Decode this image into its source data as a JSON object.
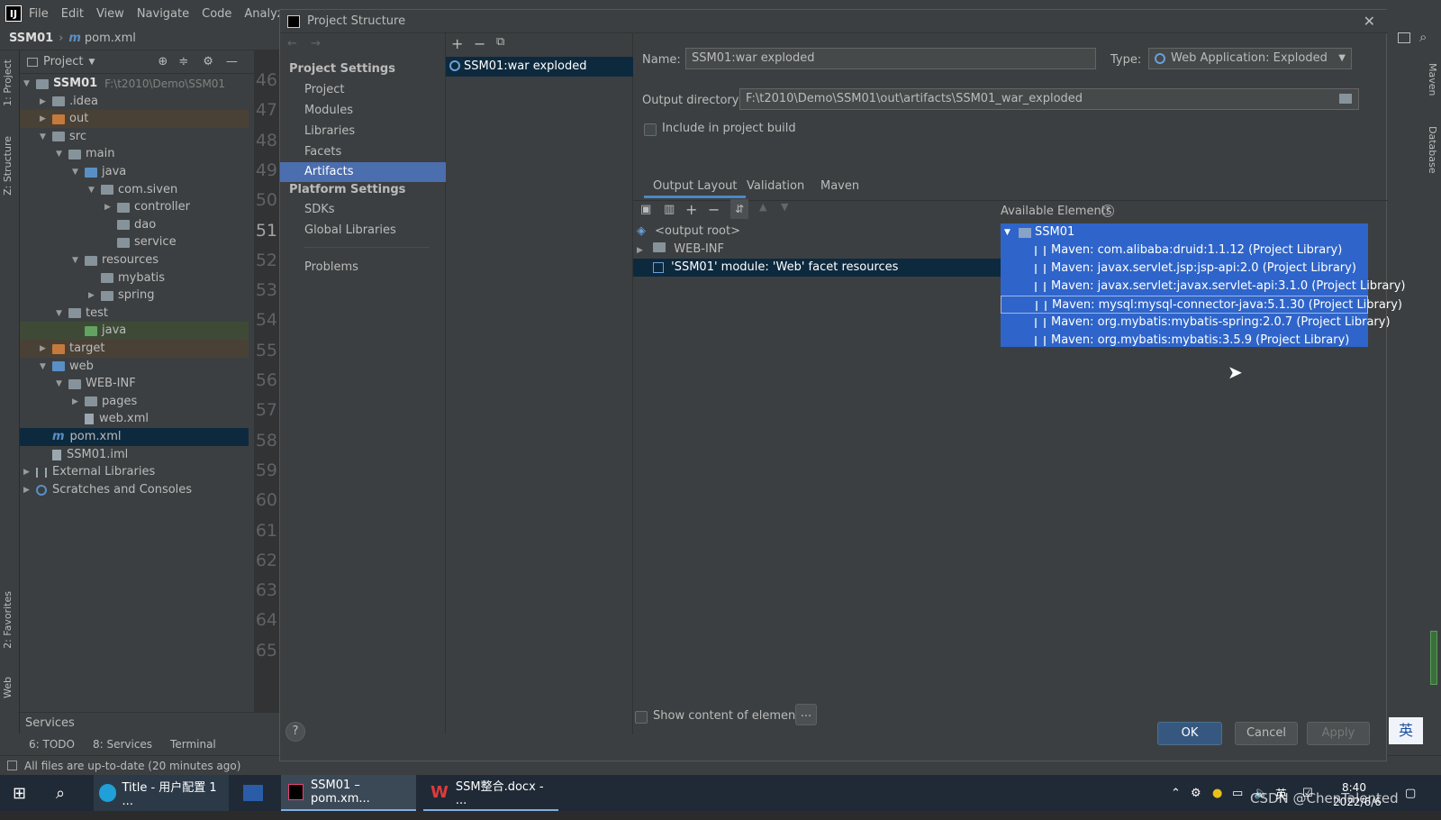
{
  "ide": {
    "menu": [
      "File",
      "Edit",
      "View",
      "Navigate",
      "Code",
      "Analyze"
    ],
    "breadcrumb": {
      "project": "SSM01",
      "file": "pom.xml"
    },
    "project_panel_title": "Project",
    "tree": [
      {
        "label": "SSM01",
        "extra": "F:\\t2010\\Demo\\SSM01",
        "depth": 0,
        "arrow": "▼",
        "kind": "module"
      },
      {
        "label": ".idea",
        "depth": 1,
        "arrow": "▶",
        "kind": "folder"
      },
      {
        "label": "out",
        "depth": 1,
        "arrow": "▶",
        "kind": "orange"
      },
      {
        "label": "src",
        "depth": 1,
        "arrow": "▼",
        "kind": "folder"
      },
      {
        "label": "main",
        "depth": 2,
        "arrow": "▼",
        "kind": "folder"
      },
      {
        "label": "java",
        "depth": 3,
        "arrow": "▼",
        "kind": "blue"
      },
      {
        "label": "com.siven",
        "depth": 4,
        "arrow": "▼",
        "kind": "folder"
      },
      {
        "label": "controller",
        "depth": 5,
        "arrow": "▶",
        "kind": "folder"
      },
      {
        "label": "dao",
        "depth": 5,
        "arrow": "",
        "kind": "folder"
      },
      {
        "label": "service",
        "depth": 5,
        "arrow": "",
        "kind": "folder"
      },
      {
        "label": "resources",
        "depth": 3,
        "arrow": "▼",
        "kind": "folder"
      },
      {
        "label": "mybatis",
        "depth": 4,
        "arrow": "",
        "kind": "folder"
      },
      {
        "label": "spring",
        "depth": 4,
        "arrow": "▶",
        "kind": "folder"
      },
      {
        "label": "test",
        "depth": 2,
        "arrow": "▼",
        "kind": "folder"
      },
      {
        "label": "java",
        "depth": 3,
        "arrow": "",
        "kind": "green"
      },
      {
        "label": "target",
        "depth": 1,
        "arrow": "▶",
        "kind": "orange"
      },
      {
        "label": "web",
        "depth": 1,
        "arrow": "▼",
        "kind": "blue"
      },
      {
        "label": "WEB-INF",
        "depth": 2,
        "arrow": "▼",
        "kind": "folder"
      },
      {
        "label": "pages",
        "depth": 3,
        "arrow": "▶",
        "kind": "folder"
      },
      {
        "label": "web.xml",
        "depth": 3,
        "arrow": "",
        "kind": "file"
      },
      {
        "label": "pom.xml",
        "depth": 1,
        "arrow": "",
        "kind": "maven"
      },
      {
        "label": "SSM01.iml",
        "depth": 1,
        "arrow": "",
        "kind": "file"
      },
      {
        "label": "External Libraries",
        "depth": 0,
        "arrow": "▶",
        "kind": "lib"
      },
      {
        "label": "Scratches and Consoles",
        "depth": 0,
        "arrow": "▶",
        "kind": "scratch"
      }
    ],
    "line_numbers": [
      "46",
      "47",
      "48",
      "49",
      "50",
      "51",
      "52",
      "53",
      "54",
      "55",
      "56",
      "57",
      "58",
      "59",
      "60",
      "61",
      "62",
      "63",
      "64",
      "65"
    ],
    "left_tabs": [
      "1: Project",
      "Z: Structure",
      "2: Favorites",
      "Web"
    ],
    "right_tabs": [
      "Maven",
      "Database"
    ],
    "services_label": "Services",
    "bottom_tabs": [
      "6: TODO",
      "8: Services",
      "Terminal"
    ],
    "status_text": "All files are up-to-date (20 minutes ago)"
  },
  "dialog": {
    "title": "Project Structure",
    "nav": {
      "project_settings_header": "Project Settings",
      "project_settings": [
        "Project",
        "Modules",
        "Libraries",
        "Facets",
        "Artifacts"
      ],
      "selected": "Artifacts",
      "platform_settings_header": "Platform Settings",
      "platform_settings": [
        "SDKs",
        "Global Libraries"
      ],
      "problems": "Problems"
    },
    "artifact": "SSM01:war exploded",
    "name_label": "Name:",
    "name_value": "SSM01:war exploded",
    "type_label": "Type:",
    "type_value": "Web Application: Exploded",
    "output_dir_label": "Output directory:",
    "output_dir_value": "F:\\t2010\\Demo\\SSM01\\out\\artifacts\\SSM01_war_exploded",
    "include_build_label": "Include in project build",
    "tabs": [
      "Output Layout",
      "Validation",
      "Maven"
    ],
    "active_tab": "Output Layout",
    "layout_tree": [
      "<output root>",
      "WEB-INF",
      "'SSM01' module: 'Web' facet resources"
    ],
    "available_title": "Available Elements",
    "available_root": "SSM01",
    "available_items": [
      "Maven: com.alibaba:druid:1.1.12 (Project Library)",
      "Maven: javax.servlet.jsp:jsp-api:2.0 (Project Library)",
      "Maven: javax.servlet:javax.servlet-api:3.1.0 (Project Library)",
      "Maven: mysql:mysql-connector-java:5.1.30 (Project Library)",
      "Maven: org.mybatis:mybatis-spring:2.0.7 (Project Library)",
      "Maven: org.mybatis:mybatis:3.5.9 (Project Library)"
    ],
    "show_content_label": "Show content of elements",
    "ellipsis": "...",
    "buttons": {
      "ok": "OK",
      "cancel": "Cancel",
      "apply": "Apply",
      "help": "?"
    }
  },
  "taskbar": {
    "items": [
      "Title - 用户配置 1 ...",
      "SSM01 – pom.xm...",
      "SSM整合.docx - ..."
    ],
    "time": "8:40",
    "date": "2022/6/6",
    "ime": "英",
    "ime_tray": "英",
    "watermark": "CSDN @ChenTalented"
  },
  "colors": {
    "selection": "#4b6eaf",
    "available_bg": "#2f65ca",
    "ok_button": "#365880"
  }
}
